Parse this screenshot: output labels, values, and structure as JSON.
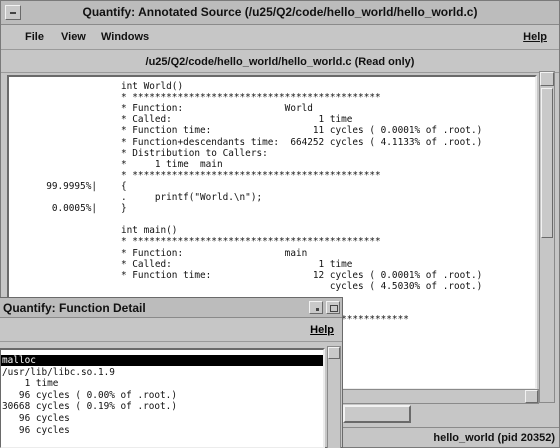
{
  "main_window": {
    "title": "Quantify: Annotated Source (/u25/Q2/code/hello_world/hello_world.c)",
    "menu": {
      "file": "File",
      "view": "View",
      "windows": "Windows",
      "help": "Help"
    },
    "path_label": "/u25/Q2/code/hello_world/hello_world.c (Read only)",
    "status": "hello_world (pid 20352)"
  },
  "source_lines": [
    {
      "pct": "",
      "code": "int World()"
    },
    {
      "pct": "",
      "code": "* ********************************************"
    },
    {
      "pct": "",
      "code": "* Function:                  World"
    },
    {
      "pct": "",
      "code": "* Called:                          1 time"
    },
    {
      "pct": "",
      "code": "* Function time:                  11 cycles ( 0.0001% of .root.)"
    },
    {
      "pct": "",
      "code": "* Function+descendants time:  664252 cycles ( 4.1133% of .root.)"
    },
    {
      "pct": "",
      "code": "* Distribution to Callers:"
    },
    {
      "pct": "",
      "code": "*     1 time  main"
    },
    {
      "pct": "",
      "code": "* ********************************************"
    },
    {
      "pct": "99.9995%|",
      "code": "{"
    },
    {
      "pct": "",
      "code": ".     printf(\"World.\\n\");"
    },
    {
      "pct": "0.0005%|",
      "code": "}"
    },
    {
      "pct": "",
      "code": ""
    },
    {
      "pct": "",
      "code": "int main()"
    },
    {
      "pct": "",
      "code": "* ********************************************"
    },
    {
      "pct": "",
      "code": "* Function:                  main"
    },
    {
      "pct": "",
      "code": "* Called:                          1 time"
    },
    {
      "pct": "",
      "code": "* Function time:                  12 cycles ( 0.0001% of .root.)"
    },
    {
      "pct": "",
      "code": "                                     cycles ( 4.5030% of .root.)"
    },
    {
      "pct": "",
      "code": ""
    },
    {
      "pct": "",
      "code": ""
    },
    {
      "pct": "",
      "code": "                                 ******************"
    }
  ],
  "detail_window": {
    "title": "Quantify: Function Detail",
    "help": "Help",
    "lines": [
      "malloc",
      "/usr/lib/libc.so.1.9",
      "    1 time",
      "   96 cycles ( 0.00% of .root.)",
      "30668 cycles ( 0.19% of .root.)",
      "   96 cycles",
      "   96 cycles"
    ]
  }
}
